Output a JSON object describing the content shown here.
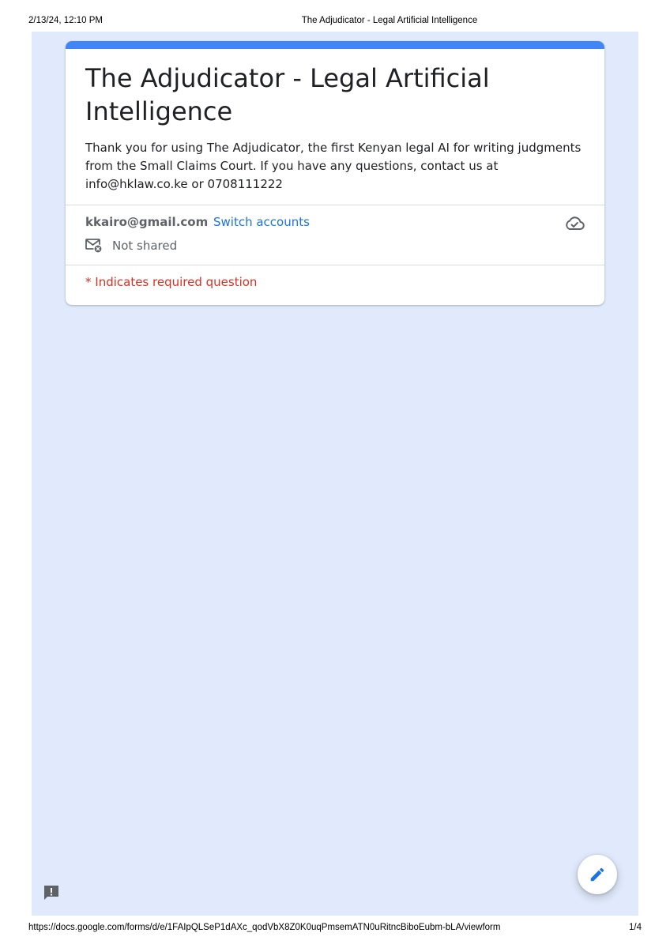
{
  "print_header": {
    "datetime": "2/13/24, 12:10 PM",
    "title": "The Adjudicator - Legal Artificial Intelligence"
  },
  "form": {
    "accent_color": "#4285f4",
    "background_color": "#e0eafc",
    "title": "The Adjudicator - Legal Artificial Intelligence",
    "description": "Thank you for using The Adjudicator, the first Kenyan legal AI for writing judgments from the Small Claims Court. If you have any questions, contact us at info@hklaw.co.ke or 0708111222",
    "account": {
      "email": "kkairo@gmail.com",
      "switch_label": "Switch accounts",
      "shared_status": "Not shared",
      "shared_icon": "mail-not-shared-icon",
      "save_icon": "cloud-done-icon"
    },
    "required_note": "* Indicates required question"
  },
  "floating": {
    "edit_icon": "pencil-icon",
    "feedback_icon": "feedback-icon"
  },
  "print_footer": {
    "url": "https://docs.google.com/forms/d/e/1FAIpQLSeP1dAXc_qodVbX8Z0K0uqPmsemATN0uRitncBiboEubm-bLA/viewform",
    "page": "1/4"
  }
}
